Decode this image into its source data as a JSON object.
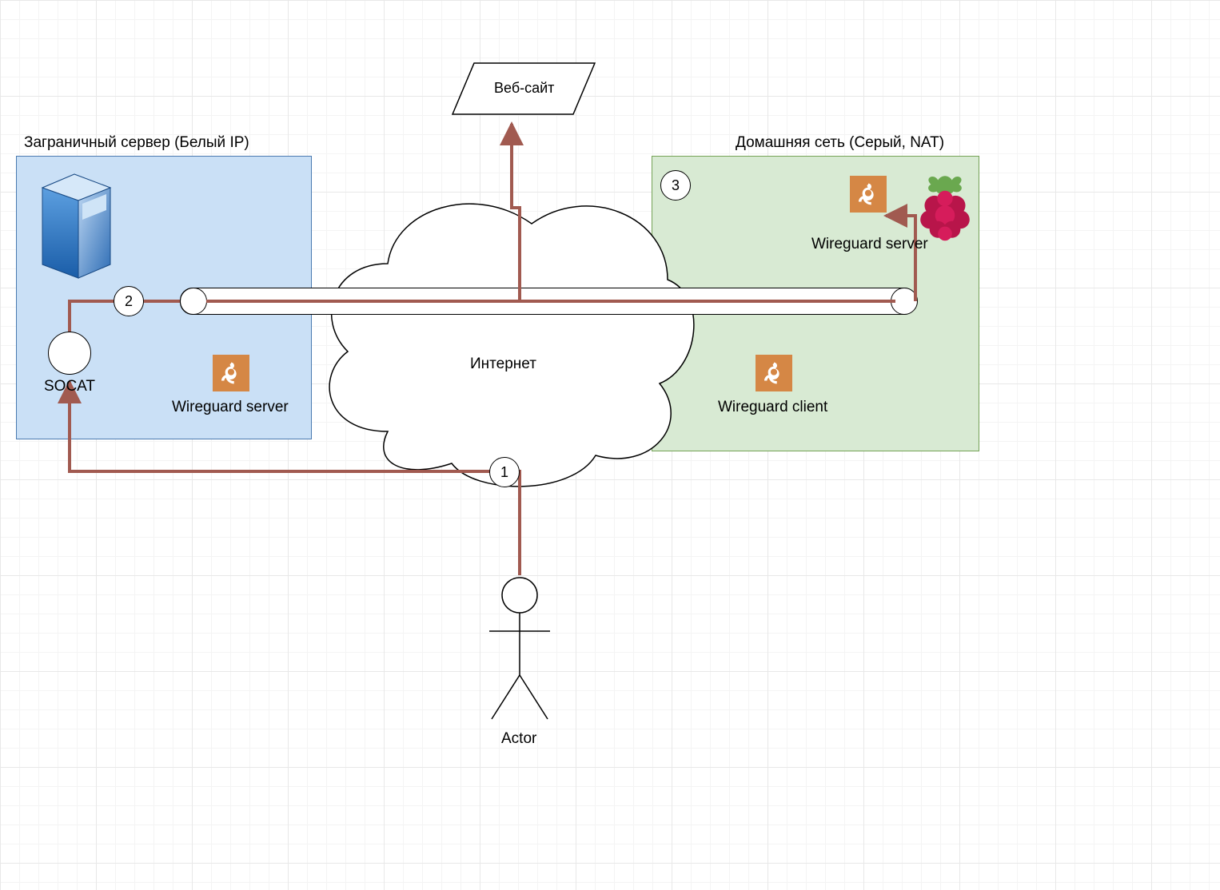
{
  "title_foreign": "Заграничный сервер (Белый IP)",
  "title_home": "Домашняя сеть (Серый, NAT)",
  "website": "Веб-сайт",
  "internet": "Интернет",
  "socat": "SOCAT",
  "wg_server": "Wireguard server",
  "wg_client": "Wireguard client",
  "actor": "Actor",
  "step1": "1",
  "step2": "2",
  "step3": "3",
  "flow_color": "#a15a50",
  "wg_color": "#d58745"
}
